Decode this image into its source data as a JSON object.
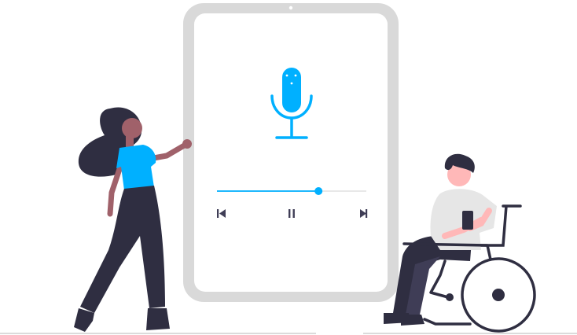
{
  "player": {
    "progress": 0.68,
    "controls": {
      "previous_icon": "skip-previous-icon",
      "pause_icon": "pause-icon",
      "next_icon": "skip-next-icon"
    },
    "mic_icon": "microphone-icon"
  },
  "colors": {
    "accent": "#00b0ff",
    "tablet_frame": "#d9d9d9",
    "screen": "#ffffff",
    "dark": "#2f2e41",
    "skin_dark": "#a0616a",
    "skin_light": "#ffb8b8",
    "shirt_gray": "#e6e6e6",
    "hair": "#2f2e41",
    "ground": "#cfcfcf",
    "controls": "#3f3d56"
  }
}
